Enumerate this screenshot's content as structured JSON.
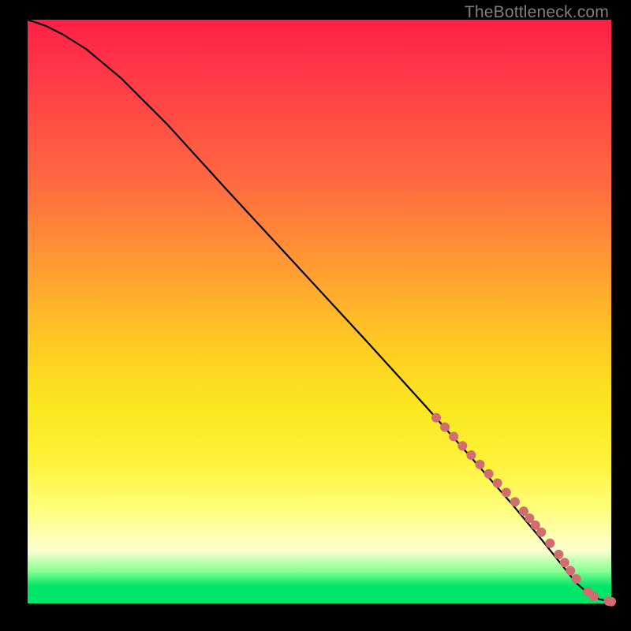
{
  "watermark": "TheBottleneck.com",
  "colors": {
    "black": "#000000",
    "curve": "#000000",
    "dot": "#d16d6f",
    "gradient_top": "#ff1f46",
    "gradient_mid": "#fae61e",
    "gradient_bottom": "#00e66a"
  },
  "chart_data": {
    "type": "line",
    "title": "",
    "xlabel": "",
    "ylabel": "",
    "xlim": [
      0,
      100
    ],
    "ylim": [
      0,
      100
    ],
    "series": [
      {
        "name": "bottleneck-curve",
        "x": [
          0,
          3,
          6,
          10,
          16,
          24,
          34,
          46,
          58,
          68,
          76,
          83,
          88,
          92,
          94,
          95.5,
          97,
          98,
          99.5,
          100
        ],
        "y": [
          100,
          99,
          97.5,
          95,
          90,
          82,
          71,
          58,
          45,
          34,
          25,
          17,
          11,
          6,
          3.5,
          2.2,
          1.2,
          0.7,
          0.4,
          0.3
        ]
      }
    ],
    "points": {
      "name": "highlighted-range",
      "x": [
        70,
        71.5,
        73,
        74.5,
        76,
        77.5,
        79,
        80.5,
        82,
        83.5,
        85,
        86,
        87,
        88,
        89.5,
        91,
        92,
        93,
        94,
        96,
        97,
        99.5,
        100
      ],
      "y": [
        31.8,
        30.2,
        28.6,
        27.0,
        25.4,
        23.8,
        22.2,
        20.6,
        19.0,
        17.4,
        15.8,
        14.6,
        13.4,
        12.2,
        10.3,
        8.4,
        7.0,
        5.6,
        4.2,
        2.0,
        1.2,
        0.4,
        0.3
      ]
    }
  }
}
